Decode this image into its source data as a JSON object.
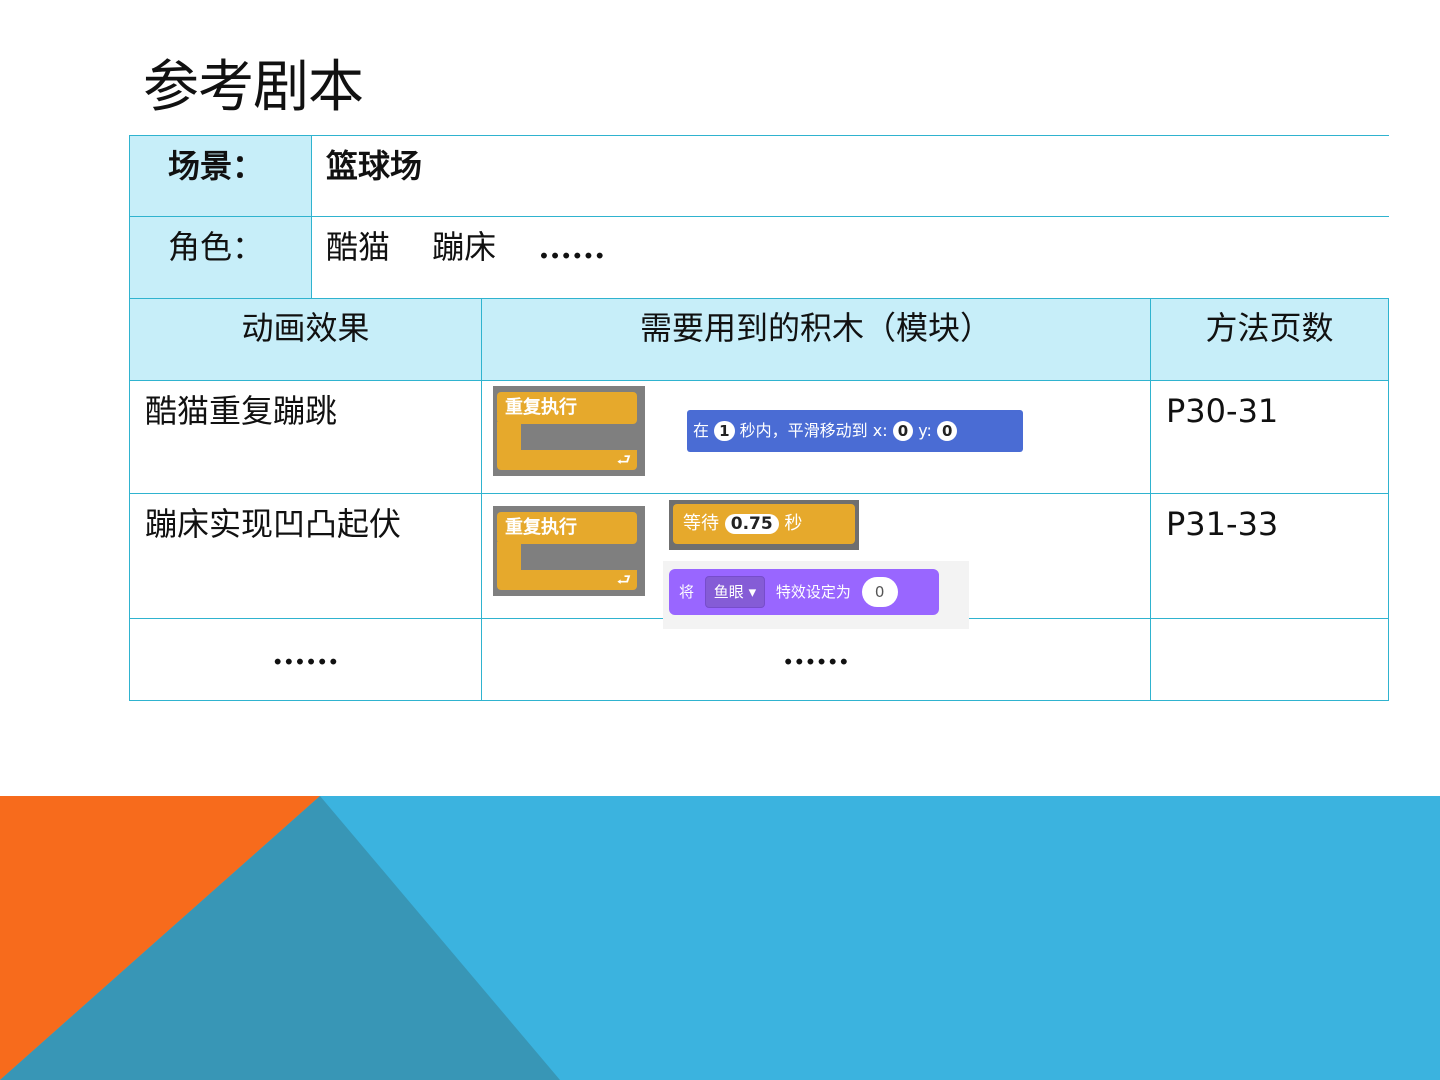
{
  "title": "参考剧本",
  "rows": {
    "scene_label": "场景：",
    "scene_value": "篮球场",
    "roles_label": "角色：",
    "roles_value": "酷猫　 蹦床　 ",
    "roles_more": "......"
  },
  "headers": {
    "effect": "动画效果",
    "blocks": "需要用到的积木（模块）",
    "pages": "方法页数"
  },
  "table": [
    {
      "effect": "酷猫重复蹦跳",
      "pages": "P30-31"
    },
    {
      "effect": "蹦床实现凹凸起伏",
      "pages": "P31-33"
    },
    {
      "effect": "......",
      "blocks": "......",
      "pages": ""
    }
  ],
  "blocks": {
    "forever": "重复执行",
    "move_prefix": "在",
    "move_secs": "1",
    "move_middle": "秒内，平滑移动到 x:",
    "move_x": "0",
    "move_y_label": "y:",
    "move_y": "0",
    "wait_label": "等待",
    "wait_value": "0.75",
    "wait_unit": "秒",
    "effect_prefix": "将",
    "effect_name": "鱼眼 ▾",
    "effect_middle": "特效设定为",
    "effect_value": "0"
  },
  "colors": {
    "header_bg": "#c7eef9",
    "border": "#2fb3cf",
    "orange": "#f76b1c",
    "blue": "#3bb3df",
    "teal": "#3896b6"
  }
}
